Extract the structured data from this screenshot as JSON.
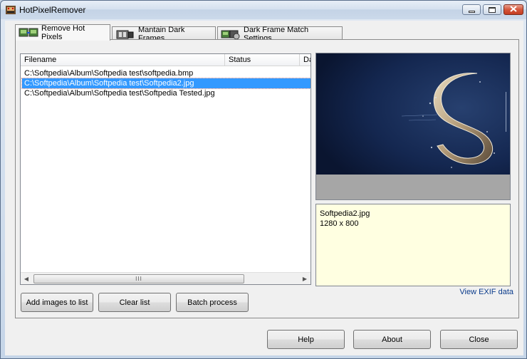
{
  "window": {
    "title": "HotPixelRemover",
    "controls": [
      "minimize-icon",
      "maximize-icon",
      "close-icon"
    ]
  },
  "tabs": [
    {
      "label": "Remove Hot Pixels",
      "icon": "photos-icon",
      "active": true
    },
    {
      "label": "Mantain Dark Frames",
      "icon": "film-icon",
      "active": false
    },
    {
      "label": "Dark Frame Match Settings",
      "icon": "photos-settings-icon",
      "active": false
    }
  ],
  "file_list": {
    "columns": [
      "Filename",
      "Status",
      "Da"
    ],
    "rows": [
      {
        "filename": "C:\\Softpedia\\Album\\Softpedia test\\softpedia.bmp",
        "status": "",
        "selected": false
      },
      {
        "filename": "C:\\Softpedia\\Album\\Softpedia test\\Softpedia2.jpg",
        "status": "",
        "selected": true
      },
      {
        "filename": "C:\\Softpedia\\Album\\Softpedia test\\Softpedia Tested.jpg",
        "status": "",
        "selected": false
      }
    ],
    "scrollbar_grip": "III"
  },
  "preview": {
    "info_name": "Softpedia2.jpg",
    "info_size": "1280 x 800",
    "exif_link": "View EXIF data"
  },
  "actions": {
    "add_images": "Add images to list",
    "clear_list": "Clear list",
    "batch_process": "Batch process"
  },
  "footer": {
    "help": "Help",
    "about": "About",
    "close": "Close"
  },
  "colors": {
    "selection": "#3399ff",
    "info_background": "#ffffe1",
    "link": "#0b3c8c",
    "preview_sky": "#0f1e3c"
  }
}
